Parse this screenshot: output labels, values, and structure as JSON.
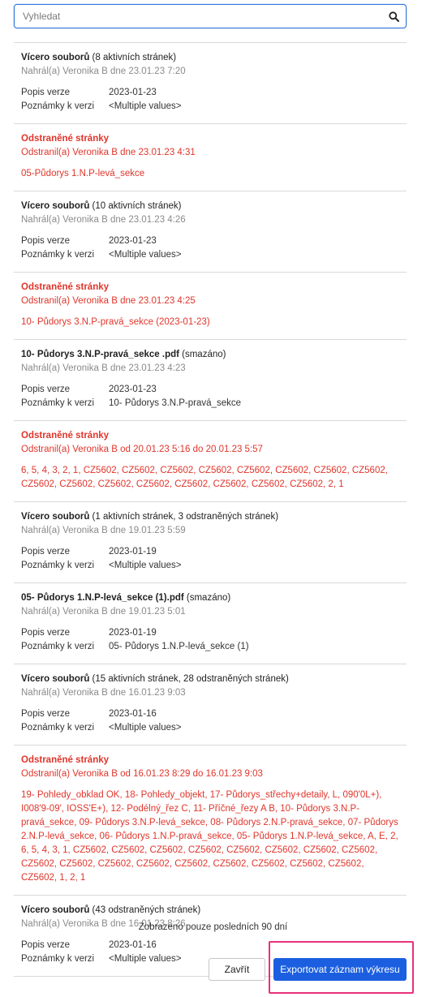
{
  "search": {
    "placeholder": "Vyhledat",
    "icon": "search-icon"
  },
  "labels": {
    "version_desc": "Popis verze",
    "version_notes": "Poznámky k verzi"
  },
  "entries": [
    {
      "kind": "upload",
      "title_bold": "Vícero souborů",
      "title_rest": " (8 aktivních stránek)",
      "sub": "Nahrál(a) Veronika B dne 23.01.23 7:20",
      "desc": "2023-01-23",
      "notes": "<Multiple values>"
    },
    {
      "kind": "deleted",
      "title": "Odstraněné stránky",
      "sub": "Odstranil(a) Veronika B dne 23.01.23 4:31",
      "pages": "05-Půdorys 1.N.P-levá_sekce"
    },
    {
      "kind": "upload",
      "title_bold": "Vícero souborů",
      "title_rest": " (10 aktivních stránek)",
      "sub": "Nahrál(a) Veronika B dne 23.01.23 4:26",
      "desc": "2023-01-23",
      "notes": "<Multiple values>"
    },
    {
      "kind": "deleted",
      "title": "Odstraněné stránky",
      "sub": "Odstranil(a) Veronika B dne 23.01.23 4:25",
      "pages": "10- Půdorys 3.N.P-pravá_sekce (2023-01-23)"
    },
    {
      "kind": "upload",
      "title_bold": "10- Půdorys 3.N.P-pravá_sekce .pdf",
      "title_rest": " (smazáno)",
      "sub": "Nahrál(a) Veronika B dne 23.01.23 4:23",
      "desc": "2023-01-23",
      "notes": "10- Půdorys 3.N.P-pravá_sekce"
    },
    {
      "kind": "deleted",
      "title": "Odstraněné stránky",
      "sub": "Odstranil(a) Veronika B od 20.01.23 5:16 do 20.01.23 5:57",
      "pages": "6, 5, 4, 3, 2, 1, CZ5602, CZ5602, CZ5602, CZ5602, CZ5602, CZ5602, CZ5602, CZ5602, CZ5602, CZ5602, CZ5602, CZ5602, CZ5602, CZ5602, CZ5602, CZ5602, 2, 1"
    },
    {
      "kind": "upload",
      "title_bold": "Vícero souborů",
      "title_rest": " (1 aktivních stránek, 3 odstraněných stránek)",
      "sub": "Nahrál(a) Veronika B dne 19.01.23 5:59",
      "desc": "2023-01-19",
      "notes": "<Multiple values>"
    },
    {
      "kind": "upload",
      "title_bold": "05- Půdorys 1.N.P-levá_sekce (1).pdf",
      "title_rest": " (smazáno)",
      "sub": "Nahrál(a) Veronika B dne 19.01.23 5:01",
      "desc": "2023-01-19",
      "notes": "05- Půdorys 1.N.P-levá_sekce  (1)"
    },
    {
      "kind": "upload",
      "title_bold": "Vícero souborů",
      "title_rest": " (15 aktivních stránek, 28 odstraněných stránek)",
      "sub": "Nahrál(a) Veronika B dne 16.01.23 9:03",
      "desc": "2023-01-16",
      "notes": "<Multiple values>"
    },
    {
      "kind": "deleted",
      "title": "Odstraněné stránky",
      "sub": "Odstranil(a) Veronika B od 16.01.23 8:29 do 16.01.23 9:03",
      "pages": "19- Pohledy_obklad OK, 18- Pohledy_objekt, 17- Půdorys_střechy+detaily, L, 090'0L+), I008'9-09', IOSS'E+), 12- Podélný_řez C, 11- Příčné_řezy A B, 10- Půdorys 3.N.P-pravá_sekce, 09- Půdorys 3.N.P-levá_sekce, 08- Půdorys 2.N.P-pravá_sekce, 07- Půdorys 2.N.P-levá_sekce, 06- Půdorys 1.N.P-pravá_sekce, 05- Půdorys 1.N.P-levá_sekce, A, E, 2, 6, 5, 4, 3, 1, CZ5602, CZ5602, CZ5602, CZ5602, CZ5602, CZ5602, CZ5602, CZ5602, CZ5602, CZ5602, CZ5602, CZ5602, CZ5602, CZ5602, CZ5602, CZ5602, CZ5602, CZ5602, 1, 2, 1"
    },
    {
      "kind": "upload",
      "title_bold": "Vícero souborů",
      "title_rest": " (43 odstraněných stránek)",
      "sub": "Nahrál(a) Veronika B dne 16.01.23 8:26",
      "desc": "2023-01-16",
      "notes": "<Multiple values>"
    }
  ],
  "footer_note": "Zobrazeno pouze posledních 90 dní",
  "buttons": {
    "close": "Zavřít",
    "export": "Exportovat záznam výkresu"
  },
  "colors": {
    "accent": "#1b5fe0",
    "deleted": "#e0352b",
    "highlight": "#e8317a"
  }
}
